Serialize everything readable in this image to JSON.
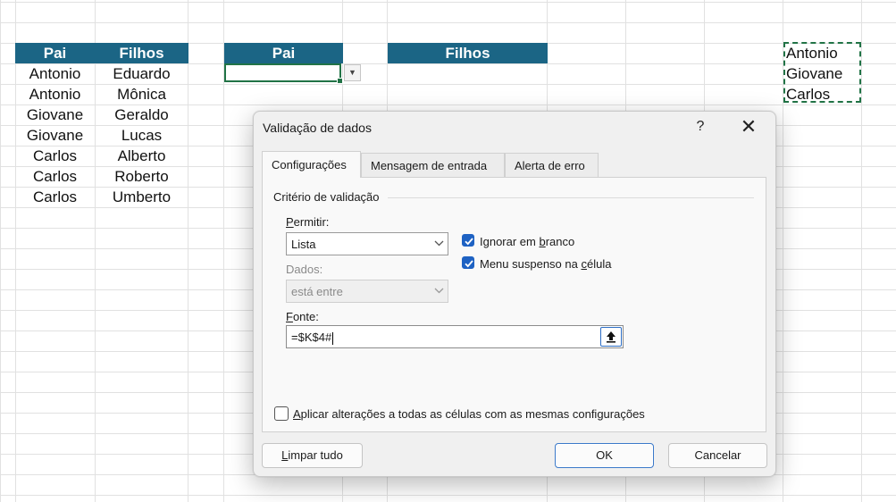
{
  "sheet": {
    "table1": {
      "header_pai": "Pai",
      "header_filhos": "Filhos",
      "rows": [
        [
          "Antonio",
          "Eduardo"
        ],
        [
          "Antonio",
          "Mônica"
        ],
        [
          "Giovane",
          "Geraldo"
        ],
        [
          "Giovane",
          "Lucas"
        ],
        [
          "Carlos",
          "Alberto"
        ],
        [
          "Carlos",
          "Roberto"
        ],
        [
          "Carlos",
          "Umberto"
        ]
      ]
    },
    "table2": {
      "header_pai": "Pai",
      "header_filhos": "Filhos"
    },
    "unique_list": [
      "Antonio",
      "Giovane",
      "Carlos"
    ],
    "dropdown_icon": "triangle-down-icon"
  },
  "dialog": {
    "title": "Validação de dados",
    "help": "?",
    "close": "✕",
    "tabs": [
      "Configurações",
      "Mensagem de entrada",
      "Alerta de erro"
    ],
    "active_tab": "Configurações",
    "group_label": "Critério de validação",
    "permitir_label": "Permitir:",
    "permitir_value": "Lista",
    "dados_label": "Dados:",
    "dados_value": "está entre",
    "fonte_label": "Fonte:",
    "fonte_value": "=$K$4#",
    "ignorar_label": "Ignorar em branco",
    "ignorar_checked": true,
    "menu_label": "Menu suspenso na célula",
    "menu_checked": true,
    "aplicar_label": "Aplicar alterações a todas as células com as mesmas configurações",
    "aplicar_checked": false,
    "btn_limpar": "Limpar tudo",
    "btn_ok": "OK",
    "btn_cancelar": "Cancelar",
    "accent_color": "#1e62c3",
    "header_color": "#1b6585"
  }
}
